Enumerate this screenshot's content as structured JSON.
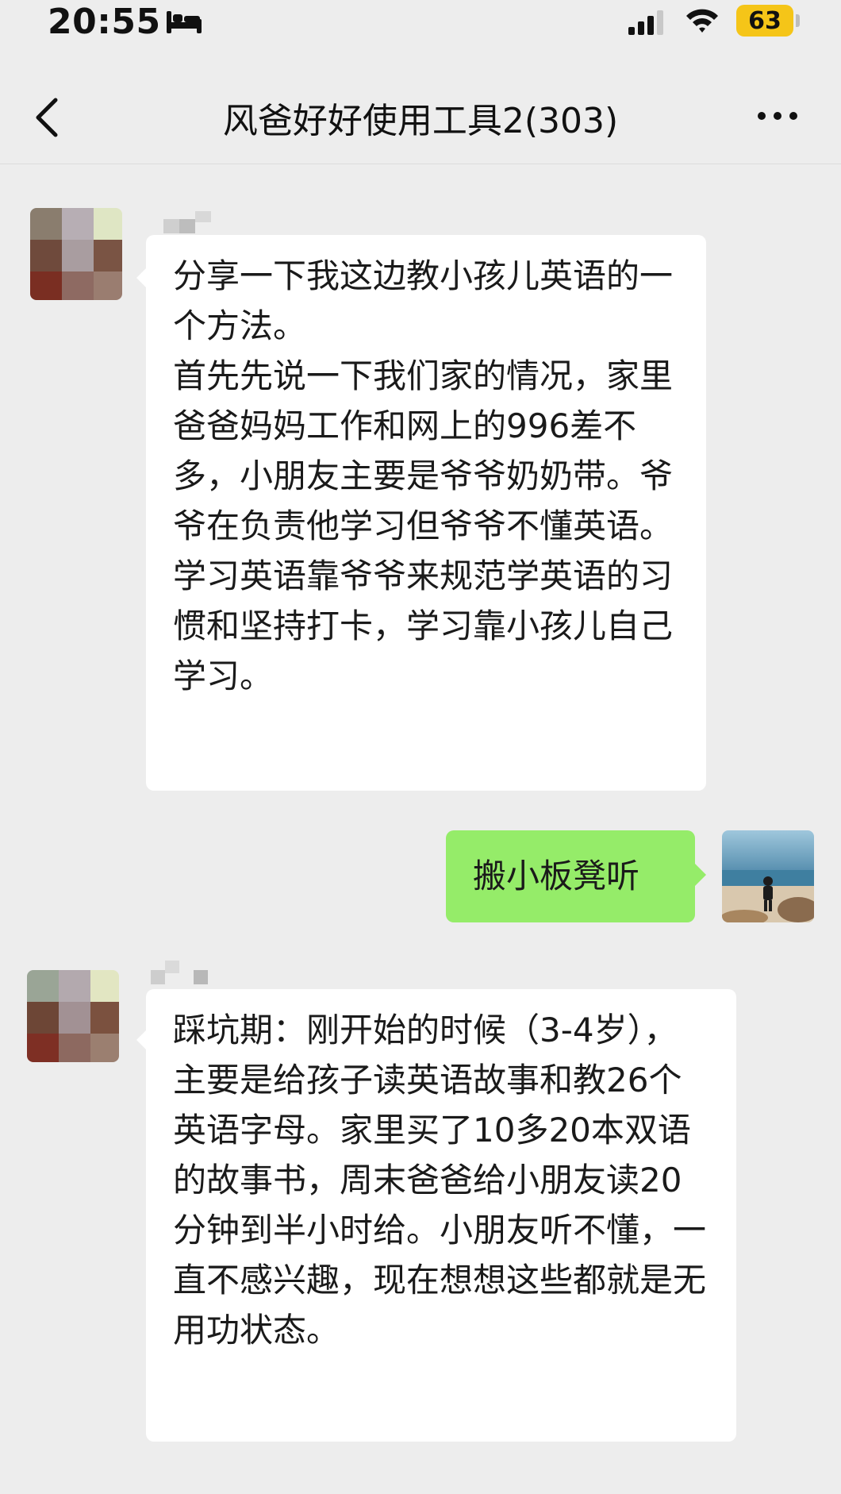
{
  "status_bar": {
    "time": "20:55",
    "battery": "63",
    "battery_color": "#f5c518",
    "icons": [
      "bed-icon",
      "signal-icon",
      "wifi-icon",
      "battery-icon"
    ]
  },
  "nav": {
    "title": "风爸好好使用工具2(303)",
    "back_icon": "chevron-left-icon",
    "more_icon": "more-dots-icon"
  },
  "colors": {
    "background": "#ededed",
    "incoming_bubble": "#ffffff",
    "outgoing_bubble": "#95ec69"
  },
  "messages": [
    {
      "direction": "incoming",
      "text": "分享一下我这边教小孩儿英语的一个方法。\n首先先说一下我们家的情况，家里爸爸妈妈工作和网上的996差不多，小朋友主要是爷爷奶奶带。爷爷在负责他学习但爷爷不懂英语。学习英语靠爷爷来规范学英语的习惯和坚持打卡，学习靠小孩儿自己学习。"
    },
    {
      "direction": "outgoing",
      "text": "搬小板凳听"
    },
    {
      "direction": "incoming",
      "text": "踩坑期：刚开始的时候（3-4岁），主要是给孩子读英语故事和教26个英语字母。家里买了10多20本双语的故事书，周末爸爸给小朋友读20分钟到半小时给。小朋友听不懂，一直不感兴趣，现在想想这些都就是无用功状态。"
    }
  ]
}
